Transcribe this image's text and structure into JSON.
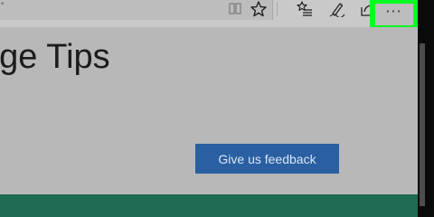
{
  "toolbar": {
    "address_text": "•",
    "reading_view_icon": "book-icon",
    "favorite_icon": "star-icon",
    "hub_icon": "favorites-list-icon",
    "web_note_icon": "pen-icon",
    "share_icon": "share-icon",
    "more_label": "···",
    "highlight_color": "#00ff22"
  },
  "page": {
    "title": "dge Tips",
    "feedback_button": "Give us feedback",
    "accent_color": "#2a5fa2",
    "footer_color": "#1f6b53"
  }
}
